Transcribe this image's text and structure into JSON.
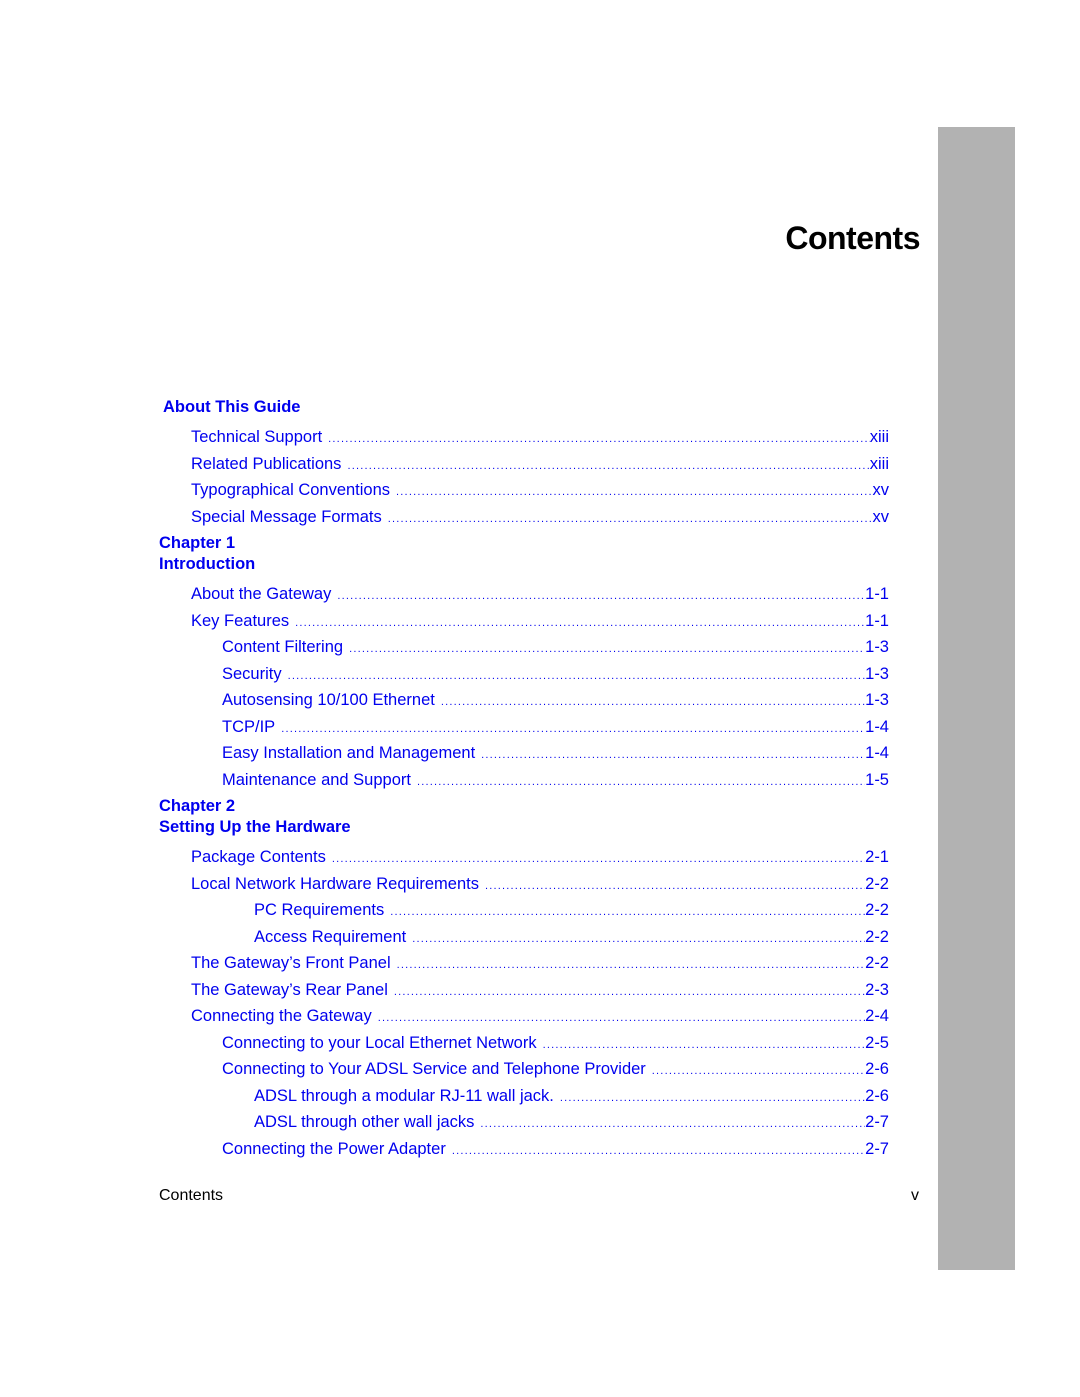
{
  "page": {
    "title": "Contents",
    "side_tab_color": "#b2b2b2",
    "link_color": "#0000ee"
  },
  "sections": [
    {
      "heading_lines": [
        "About This Guide"
      ],
      "entries": [
        {
          "label": "Technical Support",
          "page": "xiii",
          "level": 1
        },
        {
          "label": "Related Publications",
          "page": "xiii",
          "level": 1
        },
        {
          "label": "Typographical Conventions",
          "page": "xv",
          "level": 1
        },
        {
          "label": "Special Message Formats",
          "page": "xv",
          "level": 1
        }
      ]
    },
    {
      "heading_lines": [
        "Chapter 1",
        "Introduction"
      ],
      "entries": [
        {
          "label": "About the Gateway",
          "page": "1-1",
          "level": 1
        },
        {
          "label": "Key Features",
          "page": "1-1",
          "level": 1
        },
        {
          "label": "Content Filtering",
          "page": "1-3",
          "level": 2
        },
        {
          "label": "Security",
          "page": "1-3",
          "level": 2
        },
        {
          "label": "Autosensing 10/100 Ethernet",
          "page": "1-3",
          "level": 2
        },
        {
          "label": "TCP/IP",
          "page": "1-4",
          "level": 2
        },
        {
          "label": "Easy Installation and Management",
          "page": "1-4",
          "level": 2
        },
        {
          "label": "Maintenance and Support",
          "page": "1-5",
          "level": 2
        }
      ]
    },
    {
      "heading_lines": [
        "Chapter 2",
        "Setting Up the Hardware"
      ],
      "entries": [
        {
          "label": "Package Contents",
          "page": "2-1",
          "level": 1
        },
        {
          "label": "Local Network Hardware Requirements",
          "page": "2-2",
          "level": 1
        },
        {
          "label": "PC Requirements",
          "page": "2-2",
          "level": 3
        },
        {
          "label": "Access Requirement",
          "page": "2-2",
          "level": 3
        },
        {
          "label": "The Gateway’s Front Panel",
          "page": "2-2",
          "level": 1
        },
        {
          "label": "The Gateway’s Rear Panel",
          "page": "2-3",
          "level": 1
        },
        {
          "label": "Connecting the Gateway",
          "page": "2-4",
          "level": 1
        },
        {
          "label": "Connecting to your Local Ethernet Network",
          "page": "2-5",
          "level": 2
        },
        {
          "label": "Connecting to Your ADSL Service and Telephone Provider",
          "page": "2-6",
          "level": 2
        },
        {
          "label": "ADSL through a modular RJ-11 wall jack.",
          "page": "2-6",
          "level": 3
        },
        {
          "label": "ADSL through other wall jacks",
          "page": "2-7",
          "level": 3
        },
        {
          "label": "Connecting the Power Adapter",
          "page": "2-7",
          "level": 2
        }
      ]
    }
  ],
  "footer": {
    "left": "Contents",
    "right": "v"
  }
}
